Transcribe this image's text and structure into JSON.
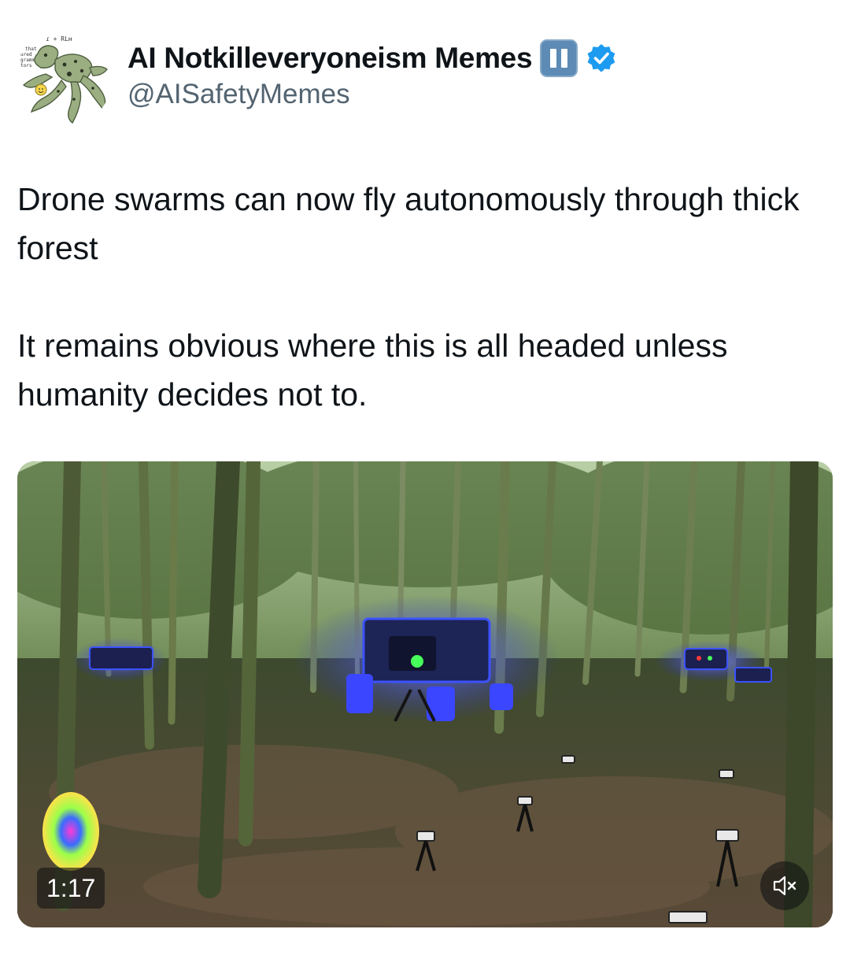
{
  "author": {
    "display_name": "AI Notkilleveryoneism Memes",
    "handle": "@AISafetyMemes",
    "avatar_icon": "octopus-shoggoth-avatar",
    "badges": [
      "pause-emoji-icon",
      "verified-badge-icon"
    ],
    "accent_color": "#1d9bf0"
  },
  "tweet": {
    "paragraphs": [
      "Drone swarms can now fly autonomously through thick forest",
      "It remains obvious where this is all headed unless humanity decides not to."
    ]
  },
  "media": {
    "type": "video",
    "duration": "1:17",
    "mute_icon": "speaker-muted-icon"
  }
}
